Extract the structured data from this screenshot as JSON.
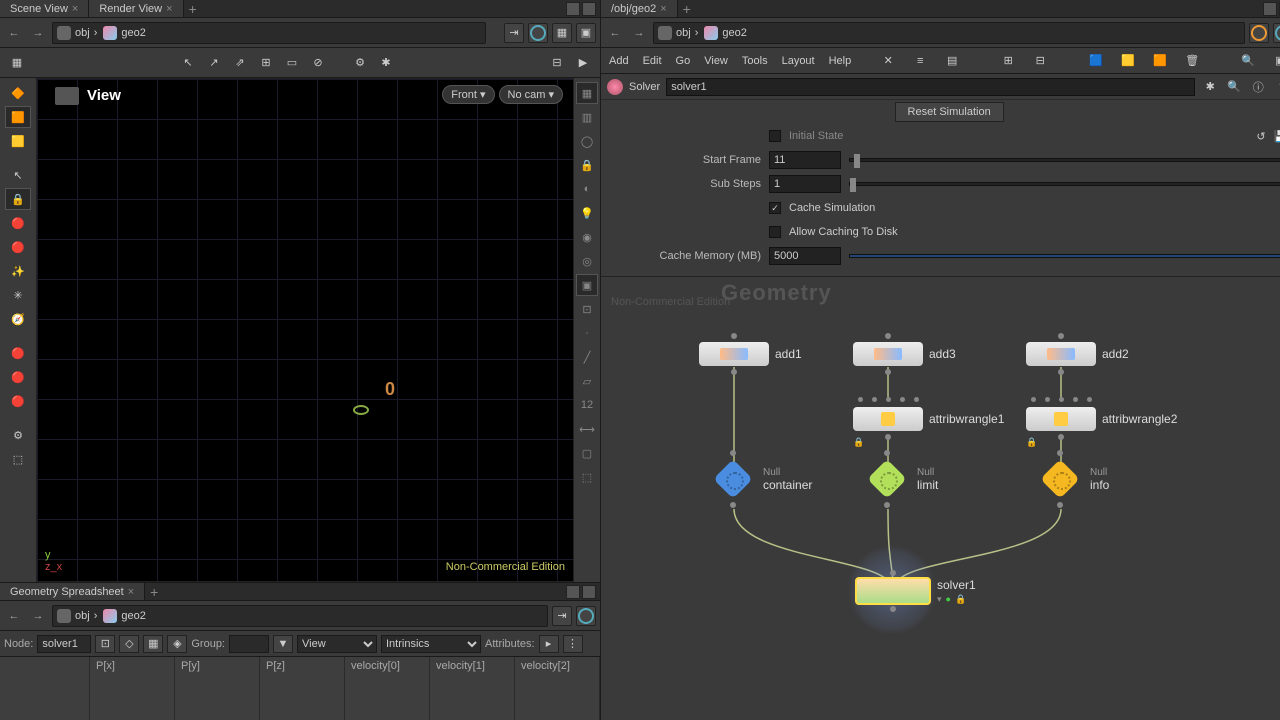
{
  "left": {
    "tabs": [
      {
        "label": "Scene View"
      },
      {
        "label": "Render View"
      }
    ],
    "path": {
      "context": "obj",
      "node": "geo2"
    },
    "viewport": {
      "label": "View",
      "cam_dd1": "Front ▾",
      "cam_dd2": "No cam ▾",
      "watermark": "Non-Commercial Edition",
      "origin": "0",
      "axis_y": "y",
      "axis_zx": "z_x"
    },
    "spreadsheet": {
      "tab": "Geometry Spreadsheet",
      "path": {
        "context": "obj",
        "node": "geo2"
      },
      "node_lbl": "Node:",
      "node_val": "solver1",
      "group_lbl": "Group:",
      "view_lbl": "View",
      "intr_lbl": "Intrinsics",
      "attr_lbl": "Attributes:",
      "cols": [
        "",
        "P[x]",
        "P[y]",
        "P[z]",
        "velocity[0]",
        "velocity[1]",
        "velocity[2]"
      ]
    }
  },
  "right": {
    "tab": "/obj/geo2",
    "path": {
      "context": "obj",
      "node": "geo2"
    },
    "menu": [
      "Add",
      "Edit",
      "Go",
      "View",
      "Tools",
      "Layout",
      "Help"
    ],
    "params": {
      "type": "Solver",
      "name": "solver1",
      "reset": "Reset Simulation",
      "rows": {
        "initial": "Initial State",
        "start_lbl": "Start Frame",
        "start_val": "11",
        "sub_lbl": "Sub Steps",
        "sub_val": "1",
        "cache_sim": "Cache Simulation",
        "cache_disk": "Allow Caching To Disk",
        "mem_lbl": "Cache Memory (MB)",
        "mem_val": "5000"
      }
    },
    "network": {
      "title": "Geometry",
      "watermark_prefix": "Non-Commercial Edition",
      "nodes": {
        "add1": "add1",
        "add2": "add2",
        "add3": "add3",
        "aw1": "attribwrangle1",
        "aw2": "attribwrangle2",
        "null_container_t": "Null",
        "null_container": "container",
        "null_limit_t": "Null",
        "null_limit": "limit",
        "null_info_t": "Null",
        "null_info": "info",
        "solver": "solver1"
      }
    }
  }
}
